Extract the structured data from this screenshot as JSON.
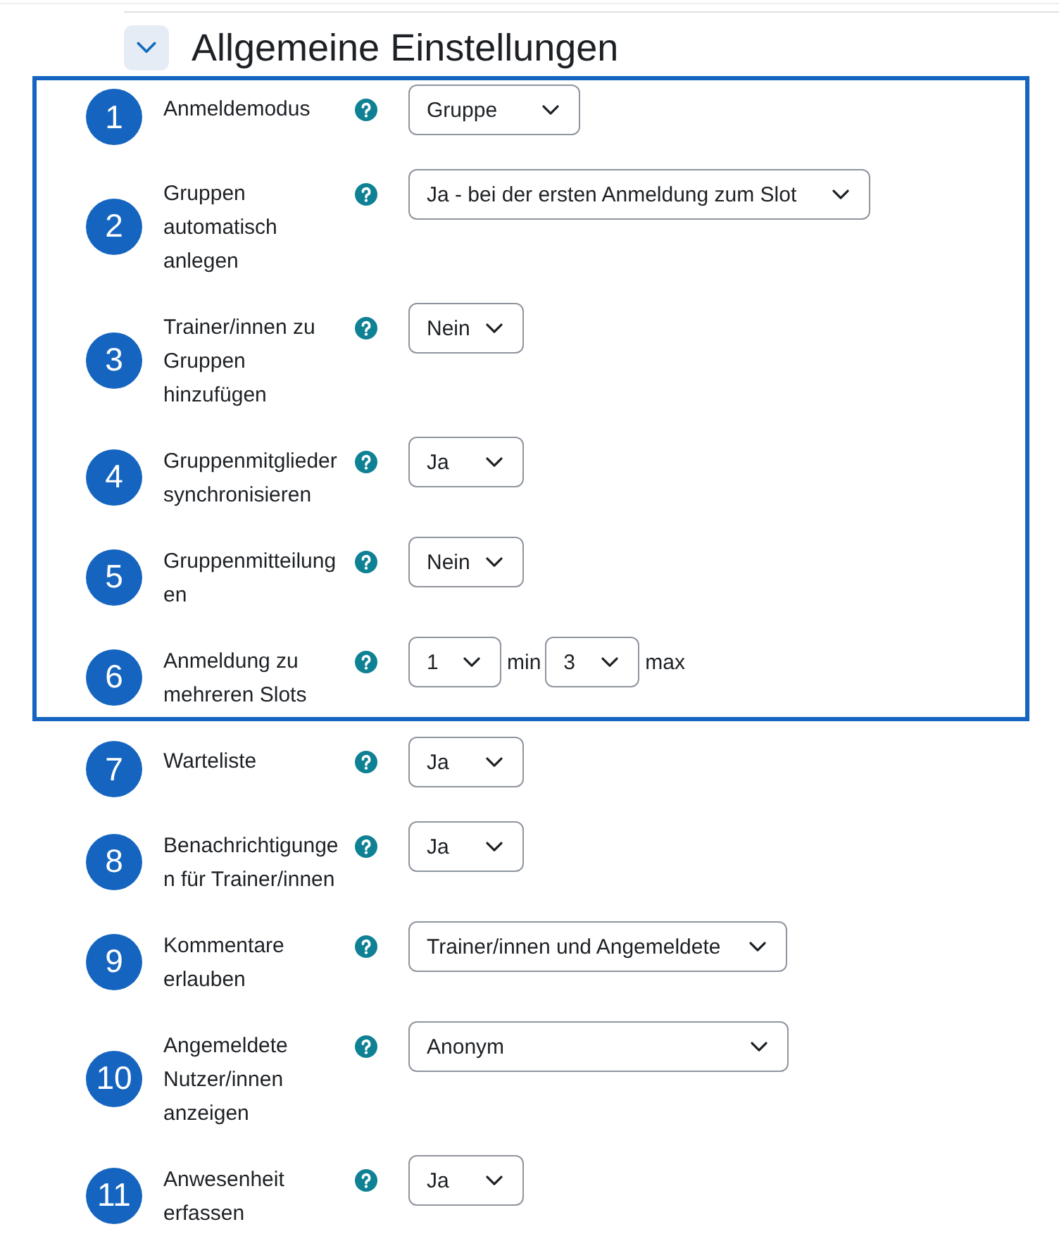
{
  "section": {
    "title": "Allgemeine Einstellungen",
    "expanded": true
  },
  "framed_settings": [
    {
      "marker": "1",
      "label": "Anmeldemodus",
      "kind": "select",
      "value": "Gruppe"
    },
    {
      "marker": "2",
      "label": "Gruppen automatisch anlegen",
      "kind": "select",
      "value": "Ja - bei der ersten Anmeldung zum Slot"
    },
    {
      "marker": "3",
      "label": "Trainer/innen zu Gruppen hinzufügen",
      "kind": "select",
      "value": "Nein"
    },
    {
      "marker": "4",
      "label": "Gruppenmitglieder synchronisieren",
      "kind": "select",
      "value": "Ja"
    },
    {
      "marker": "5",
      "label": "Gruppenmitteilungen",
      "kind": "select",
      "value": "Nein"
    },
    {
      "marker": "6",
      "label": "Anmeldung zu mehreren Slots",
      "kind": "range",
      "controls": [
        {
          "value": "1",
          "unit": "min"
        },
        {
          "value": "3",
          "unit": "max"
        }
      ]
    }
  ],
  "settings": [
    {
      "marker": "7",
      "label": "Warteliste",
      "kind": "select",
      "value": "Ja"
    },
    {
      "marker": "8",
      "label": "Benachrichtigungen für Trainer/innen",
      "kind": "select",
      "value": "Ja"
    },
    {
      "marker": "9",
      "label": "Kommentare erlauben",
      "kind": "select",
      "value": "Trainer/innen und Angemeldete"
    },
    {
      "marker": "10",
      "label": "Angemeldete Nutzer/innen anzeigen",
      "kind": "select",
      "value": "Anonym"
    },
    {
      "marker": "11",
      "label": "Anwesenheit erfassen",
      "kind": "select",
      "value": "Ja"
    }
  ]
}
